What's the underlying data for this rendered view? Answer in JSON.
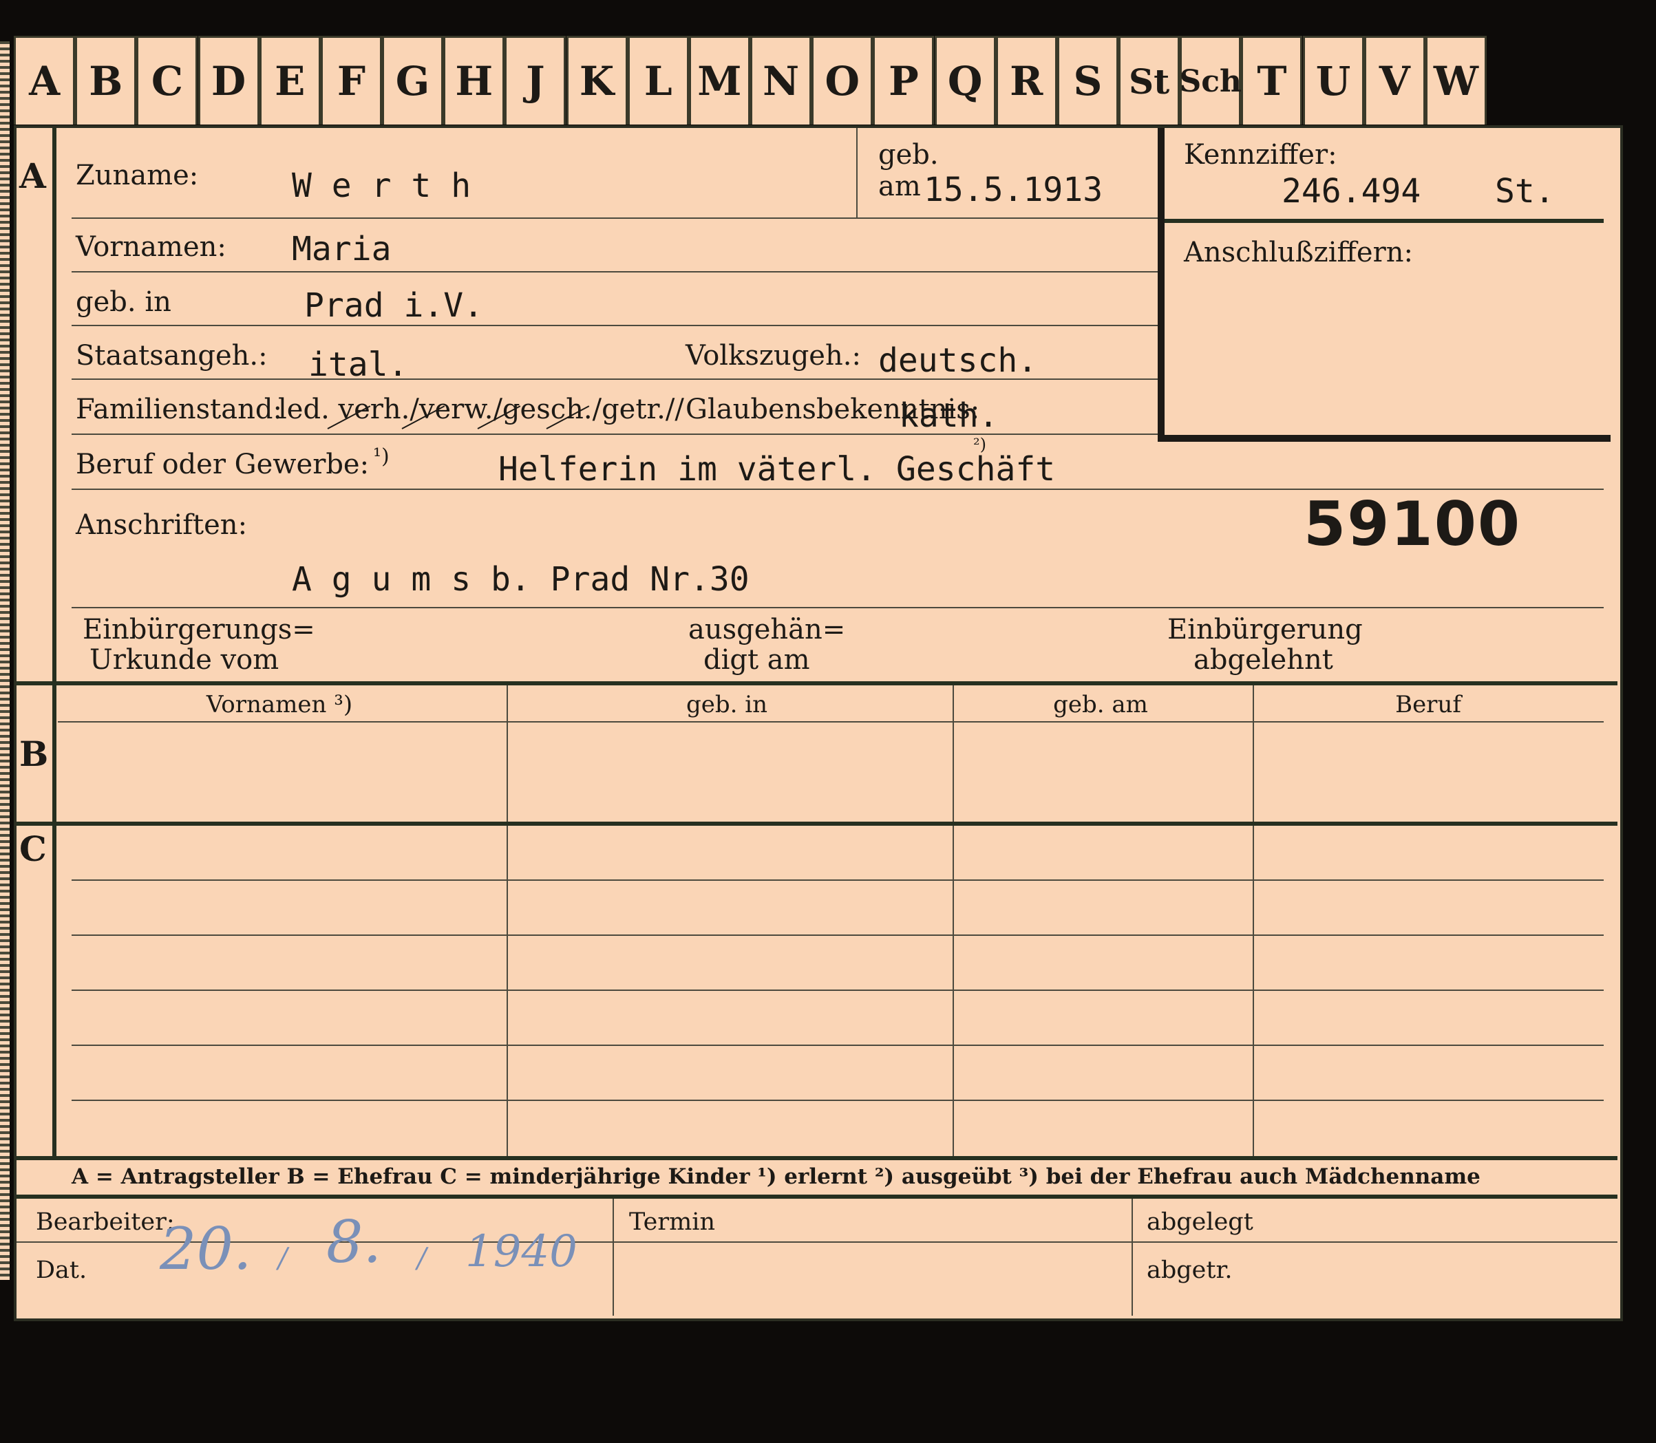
{
  "tabs": [
    "A",
    "B",
    "C",
    "D",
    "E",
    "F",
    "G",
    "H",
    "J",
    "K",
    "L",
    "M",
    "N",
    "O",
    "P",
    "Q",
    "R",
    "S",
    "St",
    "Sch",
    "T",
    "U",
    "V",
    "W"
  ],
  "section_letters": {
    "a": "A",
    "b": "B",
    "c": "C"
  },
  "labels": {
    "zuname": "Zuname:",
    "geb": "geb.",
    "am": "am",
    "kennziffer": "Kennziffer:",
    "anschlussziffern": "Anschlußziffern:",
    "vornamen": "Vornamen:",
    "geb_in": "geb. in",
    "staatsangeh": "Staatsangeh.:",
    "volkszugeh": "Volkszugeh.:",
    "familienstand": "Familienstand:",
    "familienstand_options": "led. verh./verw./gesch./getr.//",
    "glaubensbekenntnis": "Glaubensbekenntnis:",
    "beruf": "Beruf oder Gewerbe:",
    "beruf_note": "¹)",
    "anschriften": "Anschriften:",
    "einbuergerung_urkunde_1": "Einbürgerungs=",
    "einbuergerung_urkunde_2": "Urkunde vom",
    "ausgehaendigt_1": "ausgehän=",
    "ausgehaendigt_2": "digt am",
    "einbuergerung_abgelehnt_1": "Einbürgerung",
    "einbuergerung_abgelehnt_2": "abgelehnt",
    "legend": "A = Antragsteller   B = Ehefrau   C = minderjährige Kinder   ¹) erlernt   ²) ausgeübt   ³) bei der Ehefrau auch Mädchenname",
    "bearbeiter": "Bearbeiter:",
    "dat": "Dat.",
    "termin": "Termin",
    "abgelegt": "abgelegt",
    "abgetr": "abgetr."
  },
  "table_headers": [
    "Vornamen ³)",
    "geb. in",
    "geb. am",
    "Beruf"
  ],
  "values": {
    "zuname": "W e r t h",
    "geb_am": "15.5.1913",
    "kennziffer": "246.494",
    "kennziffer_suffix": "St.",
    "vornamen": "Maria",
    "geb_in": "Prad i.V.",
    "staatsangeh": "ital.",
    "volkszugeh": "deutsch.",
    "glaubensbekenntnis": "kath.",
    "beruf": "Helferin im väterl. Geschäft",
    "beruf_note": "²)",
    "number": "59100",
    "anschrift": "A g u m s  b. Prad Nr.30",
    "date_day": "20.",
    "date_month": "8.",
    "date_year": "1940",
    "date_sep": "/"
  }
}
